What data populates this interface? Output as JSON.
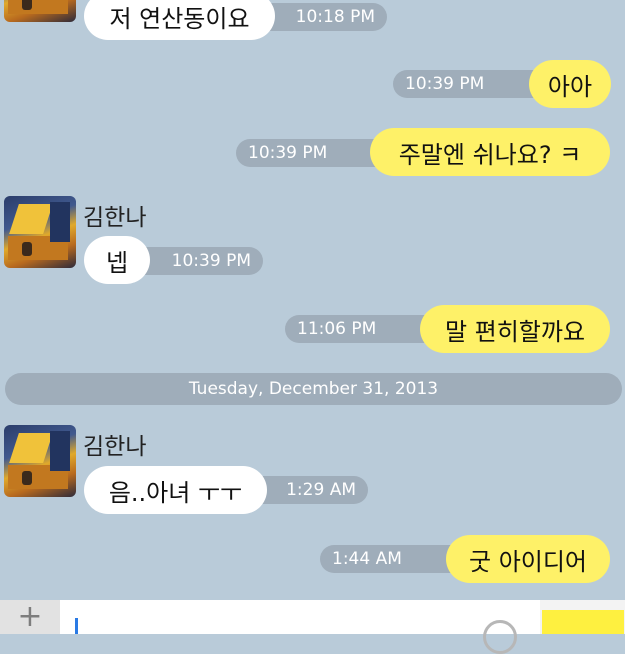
{
  "messages": [
    {
      "sender": "other",
      "text": "저 연산동이요",
      "time": "10:18 PM"
    },
    {
      "sender": "me",
      "text": "아아",
      "time": "10:39 PM"
    },
    {
      "sender": "me",
      "text": "주말엔 쉬나요? ㅋ",
      "time": "10:39 PM"
    },
    {
      "sender": "other",
      "name": "김한나",
      "text": "넵",
      "time": "10:39 PM"
    },
    {
      "sender": "me",
      "text": "말 편히할까요",
      "time": "11:06 PM"
    },
    {
      "sender": "other",
      "name": "김한나",
      "text": "음..아녀 ㅜㅜ",
      "time": "1:29 AM"
    },
    {
      "sender": "me",
      "text": "굿 아이디어",
      "time": "1:44 AM"
    }
  ],
  "date_divider": "Tuesday, December 31, 2013",
  "input_bar": {
    "plus_icon": "+",
    "text": ""
  },
  "colors": {
    "background": "#b9cbd9",
    "my_bubble": "#fef168",
    "their_bubble": "#ffffff",
    "time_pill": "#9fadba",
    "send_button": "#fef040"
  }
}
